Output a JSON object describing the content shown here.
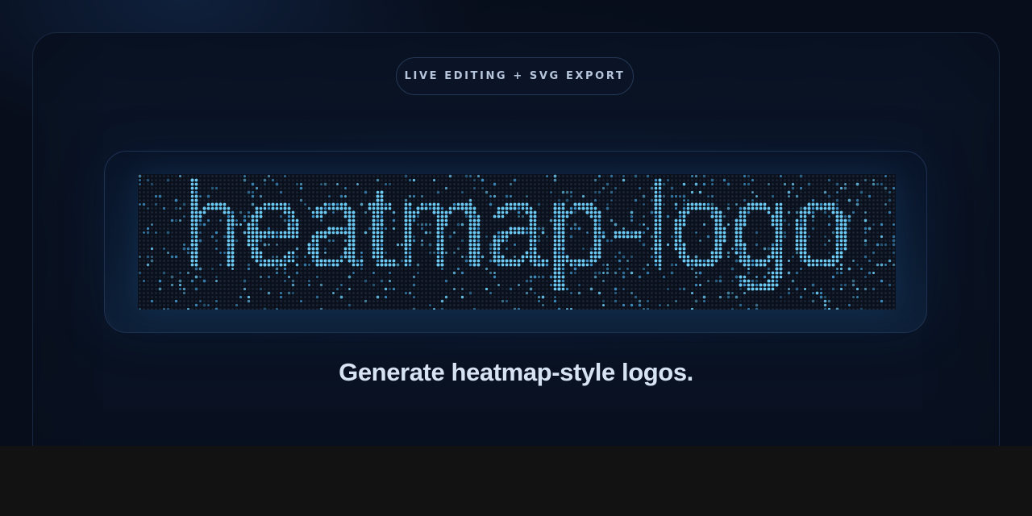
{
  "badge": {
    "label": "LIVE EDITING + SVG EXPORT"
  },
  "logo": {
    "text": "heatmap-logo",
    "style": "dot-matrix heatmap",
    "colors": {
      "dot_on": "#6ccaf4",
      "dot_mid": "#3f91c6",
      "dot_off": "#1c2637",
      "background": "#0b111c"
    }
  },
  "tagline": {
    "text": "Generate heatmap-style logos."
  }
}
